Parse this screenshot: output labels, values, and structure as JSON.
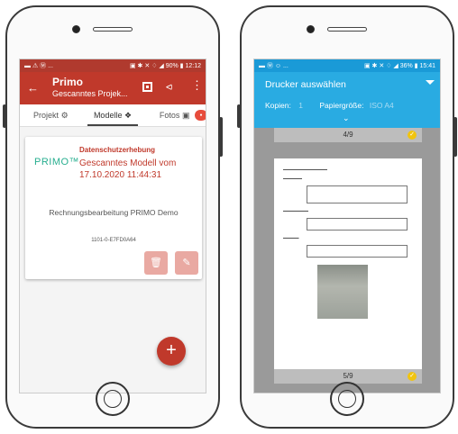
{
  "left_phone": {
    "status": {
      "left": "▬ ⚠ Ⓜ ...",
      "right": "▣ ✱ ✕ ♢ ◢ 90% ▮ 12:12"
    },
    "appbar": {
      "title": "Primo",
      "subtitle": "Gescanntes Projek..."
    },
    "tabs": [
      {
        "label": "Projekt"
      },
      {
        "label": "Modelle"
      },
      {
        "label": "Fotos"
      }
    ],
    "card": {
      "logo": "PRIMO™",
      "type": "Datenschutzerhebung",
      "title": "Gescanntes Modell vom 17.10.2020 11:44:31",
      "description": "Rechnungsbearbeitung PRIMO Demo",
      "code": "1101-0-E7FD0A64"
    }
  },
  "right_phone": {
    "status": {
      "left": "▬ Ⓜ ☺ ...",
      "right": "▣ ✱ ✕ ♢ ◢ 36% ▮ 15:41"
    },
    "header": {
      "title": "Drucker auswählen",
      "copies_label": "Kopien:",
      "copies_value": "1",
      "paper_label": "Papiergröße:",
      "paper_value": "ISO A4"
    },
    "pages": [
      {
        "label": "4/9"
      },
      {
        "label": "5/9"
      }
    ]
  },
  "colors": {
    "primo_red": "#c0392b",
    "print_blue": "#29abe2",
    "logo_teal": "#27ae8f",
    "check_yellow": "#f1c40f"
  }
}
